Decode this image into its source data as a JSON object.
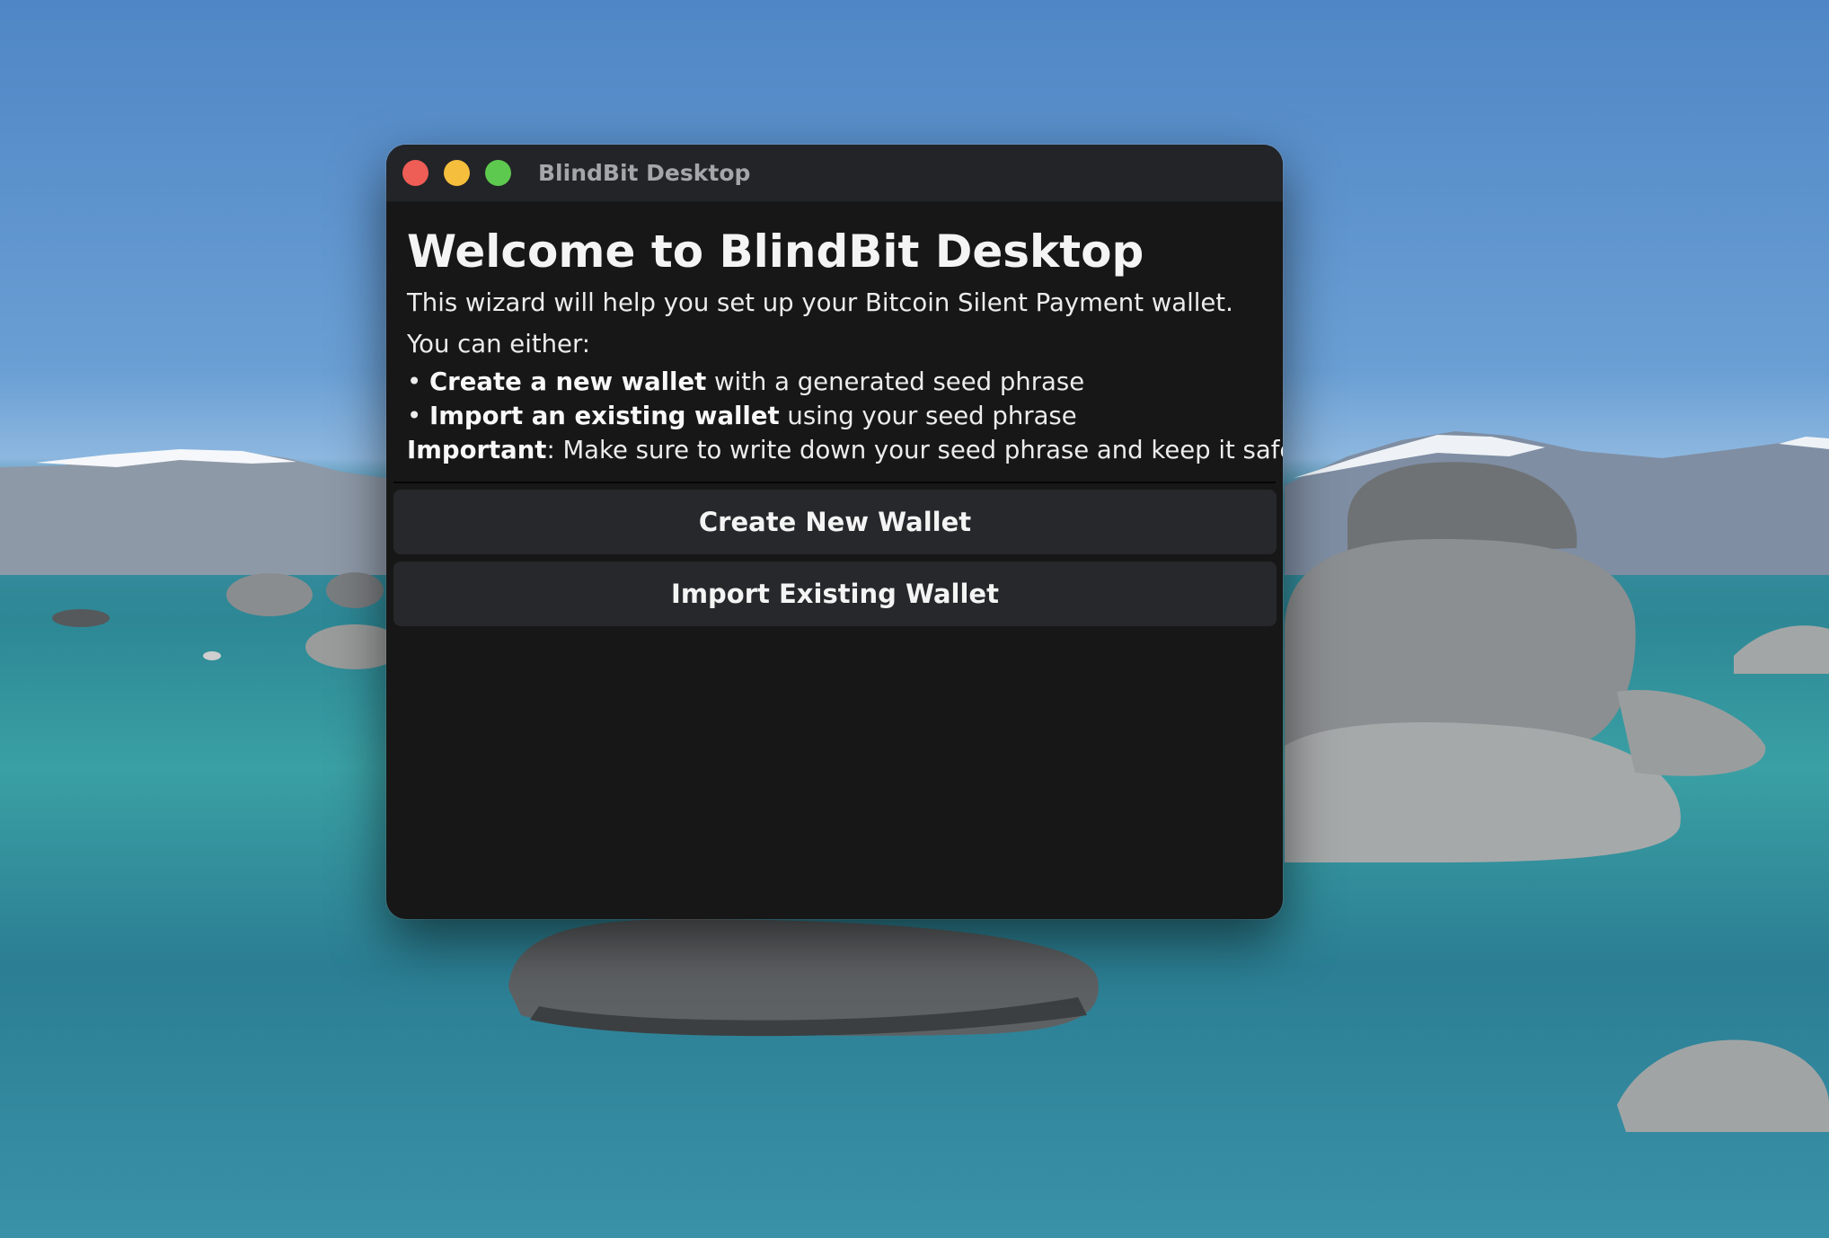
{
  "window": {
    "title": "BlindBit Desktop"
  },
  "welcome": {
    "heading": "Welcome to BlindBit Desktop",
    "intro": "This wizard will help you set up your Bitcoin Silent Payment wallet.",
    "either": "You can either:",
    "options": [
      {
        "bold": "Create a new wallet",
        "rest": " with a generated seed phrase"
      },
      {
        "bold": "Import an existing wallet",
        "rest": " using your seed phrase"
      }
    ],
    "important_label": "Important",
    "important_text": ": Make sure to write down your seed phrase and keep it safe!"
  },
  "buttons": {
    "create": "Create New Wallet",
    "import": "Import Existing Wallet"
  },
  "colors": {
    "window_bg": "#171717",
    "titlebar_bg": "#222427",
    "button_bg": "#27282c",
    "close": "#ee5d56",
    "minimize": "#f5be3c",
    "maximize": "#5ec94f"
  },
  "icons": {
    "close": "close-icon",
    "minimize": "minimize-icon",
    "maximize": "maximize-icon"
  }
}
